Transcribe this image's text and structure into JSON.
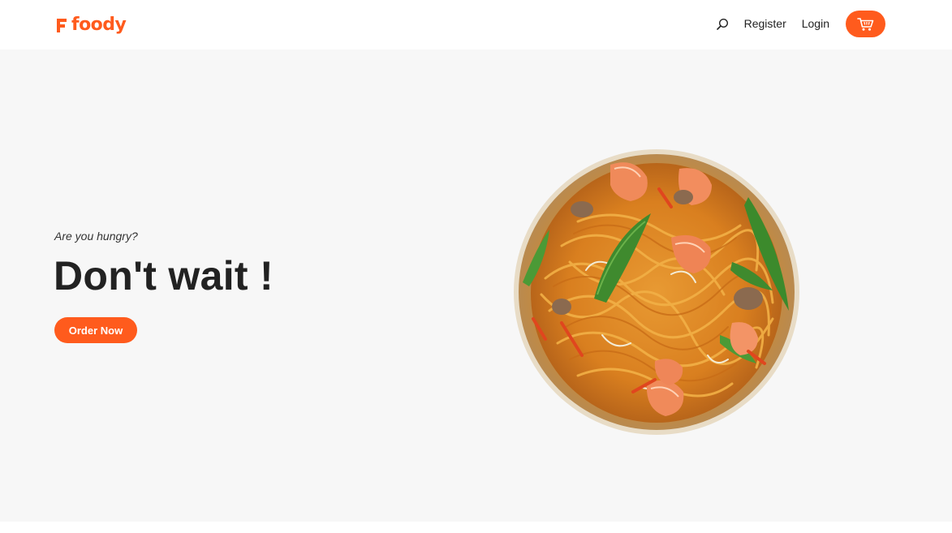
{
  "brand": {
    "name": "foody",
    "color": "#ff5b1d"
  },
  "header": {
    "icons": {
      "search": "search-icon",
      "cart": "cart-icon"
    },
    "nav": {
      "register": "Register",
      "login": "Login"
    }
  },
  "hero": {
    "subtitle": "Are you hungry?",
    "title": "Don't wait !",
    "cta_label": "Order Now",
    "background": "#f7f7f7",
    "image": "noodle-dish-image"
  }
}
